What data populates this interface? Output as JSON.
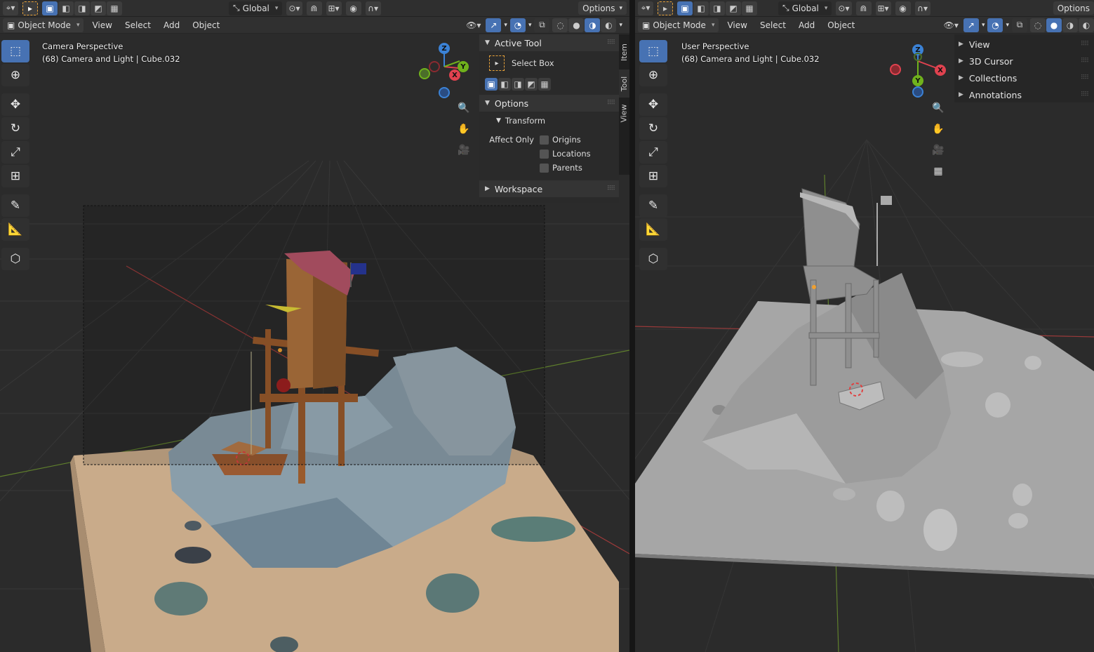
{
  "left": {
    "header": {
      "editor_icon": "3d-viewport-icon",
      "orientation": "Global",
      "options": "Options",
      "mode": "Object Mode",
      "menus": [
        "View",
        "Select",
        "Add",
        "Object"
      ]
    },
    "overlay": {
      "line1": "Camera Perspective",
      "line2": "(68) Camera and Light | Cube.032"
    },
    "gizmo": {
      "x": "X",
      "y": "Y",
      "z": "Z"
    },
    "npanel": {
      "tabs": [
        "Item",
        "Tool",
        "View"
      ],
      "active_tab": "Tool",
      "active_tool_title": "Active Tool",
      "tool_name": "Select Box",
      "options_title": "Options",
      "transform_title": "Transform",
      "affect_only": "Affect Only",
      "checks": [
        "Origins",
        "Locations",
        "Parents"
      ],
      "workspace_title": "Workspace"
    }
  },
  "right": {
    "header": {
      "orientation": "Global",
      "options": "Options",
      "mode": "Object Mode",
      "menus": [
        "View",
        "Select",
        "Add",
        "Object"
      ]
    },
    "overlay": {
      "line1": "User Perspective",
      "line2": "(68) Camera and Light | Cube.032"
    },
    "gizmo": {
      "x": "X",
      "y": "Y",
      "z": "Z"
    },
    "outliner": [
      "View",
      "3D Cursor",
      "Collections",
      "Annotations"
    ]
  },
  "colors": {
    "accent": "#4772b3",
    "x_axis": "#e0424f",
    "y_axis": "#70b21c",
    "z_axis": "#3b82d6",
    "sand": "#c9ab8a",
    "rock": "#7f98a8"
  }
}
